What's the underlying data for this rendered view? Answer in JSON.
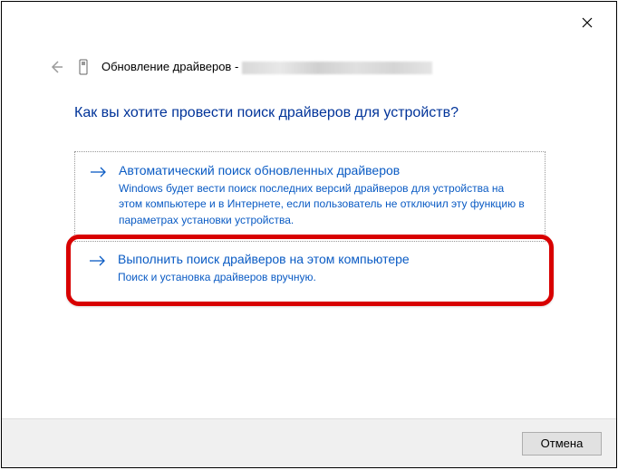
{
  "window": {
    "title_prefix": "Обновление драйверов -"
  },
  "heading": "Как вы хотите провести поиск драйверов для устройств?",
  "options": [
    {
      "title": "Автоматический поиск обновленных драйверов",
      "description": "Windows будет вести поиск последних версий драйверов для устройства на этом компьютере и в Интернете, если пользователь не отключил эту функцию в параметрах установки устройства."
    },
    {
      "title": "Выполнить поиск драйверов на этом компьютере",
      "description": "Поиск и установка драйверов вручную."
    }
  ],
  "buttons": {
    "cancel": "Отмена"
  }
}
